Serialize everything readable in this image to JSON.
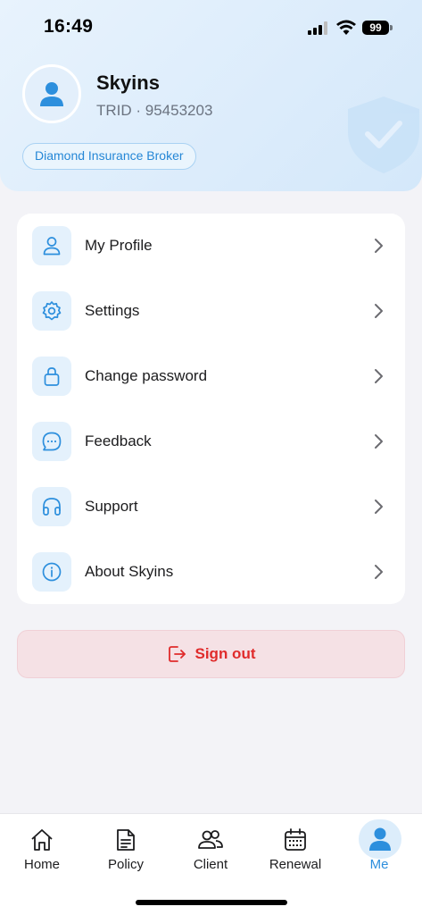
{
  "status_bar": {
    "time": "16:49",
    "battery": "99"
  },
  "profile": {
    "name": "Skyins",
    "trid": "TRID · 95453203",
    "badge": "Diamond Insurance Broker"
  },
  "menu": {
    "items": [
      {
        "label": "My Profile",
        "icon": "user-icon"
      },
      {
        "label": "Settings",
        "icon": "gear-icon"
      },
      {
        "label": "Change password",
        "icon": "lock-icon"
      },
      {
        "label": "Feedback",
        "icon": "chat-bubble-icon"
      },
      {
        "label": "Support",
        "icon": "headphones-icon"
      },
      {
        "label": "About Skyins",
        "icon": "info-icon"
      }
    ]
  },
  "signout": {
    "label": "Sign out",
    "icon": "logout-icon"
  },
  "tabbar": {
    "tabs": [
      {
        "label": "Home",
        "icon": "home-icon"
      },
      {
        "label": "Policy",
        "icon": "document-icon"
      },
      {
        "label": "Client",
        "icon": "users-icon"
      },
      {
        "label": "Renewal",
        "icon": "calendar-icon"
      },
      {
        "label": "Me",
        "icon": "person-icon",
        "active": true
      }
    ]
  },
  "colors": {
    "accent": "#2d8fdd",
    "danger": "#e02b2b",
    "signout_bg": "#f5e1e5",
    "header_bg": "#dcecfb",
    "icon_tile": "#e4f1fc"
  }
}
